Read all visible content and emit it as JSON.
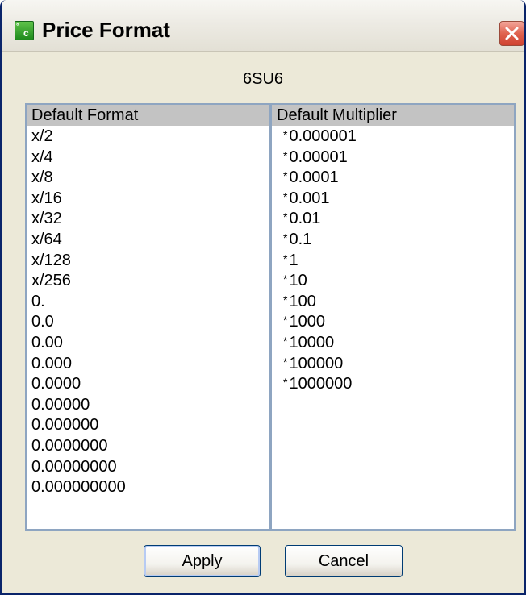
{
  "window": {
    "title": "Price Format",
    "icon": "price-format-app-icon",
    "icon_text_a": "°",
    "icon_text_b": "c"
  },
  "symbol": "6SU6",
  "format_list": {
    "header": "Default Format",
    "items": [
      "x/2",
      "x/4",
      "x/8",
      "x/16",
      "x/32",
      "x/64",
      "x/128",
      "x/256",
      "0.",
      "0.0",
      "0.00",
      "0.000",
      "0.0000",
      "0.00000",
      "0.000000",
      "0.0000000",
      "0.00000000",
      "0.000000000"
    ]
  },
  "multiplier_list": {
    "header": "Default Multiplier",
    "prefix": "*",
    "items": [
      "0.000001",
      "0.00001",
      "0.0001",
      "0.001",
      "0.01",
      "0.1",
      "1",
      "10",
      "100",
      "1000",
      "10000",
      "100000",
      "1000000"
    ]
  },
  "buttons": {
    "apply": "Apply",
    "cancel": "Cancel"
  },
  "colors": {
    "dialog_bg": "#ece9d8",
    "list_header_bg": "#c3c3c3",
    "close_button": "#e0634f",
    "focus_ring": "#b7cbf3"
  }
}
